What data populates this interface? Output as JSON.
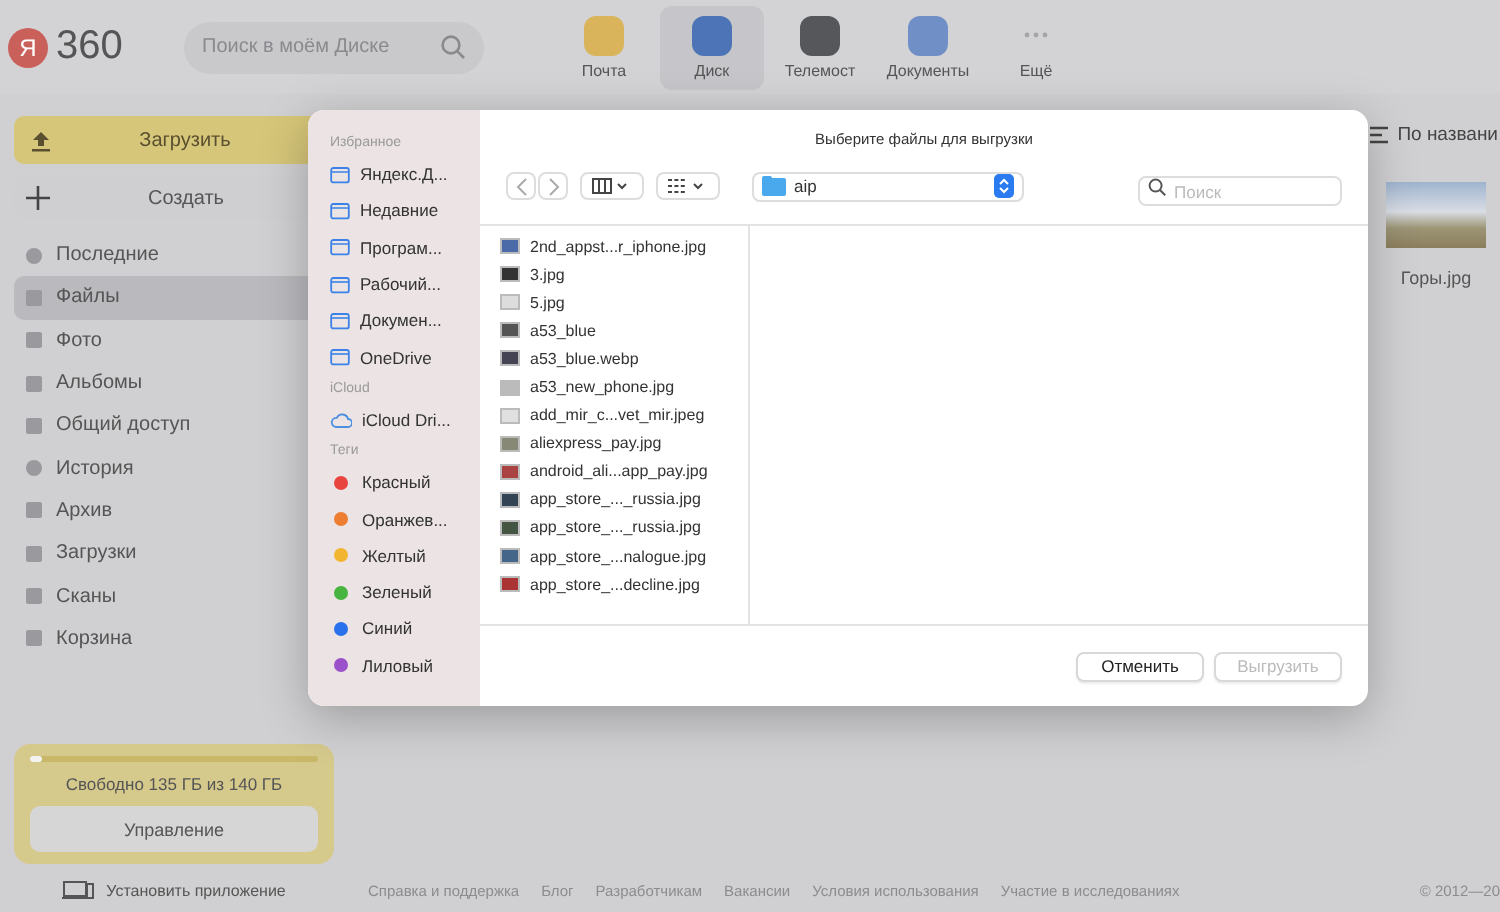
{
  "header": {
    "logo_mark": "Я",
    "logo_text": "360",
    "search": {
      "placeholder": "Поиск в моём Диске"
    },
    "apps": [
      {
        "label": "Почта",
        "selected": false
      },
      {
        "label": "Диск",
        "selected": true
      },
      {
        "label": "Телемост",
        "selected": false
      },
      {
        "label": "Документы",
        "selected": false
      },
      {
        "label": "Ещё",
        "selected": false
      }
    ]
  },
  "sidebar": {
    "upload_button": "Загрузить",
    "create_button": "Создать",
    "items": [
      {
        "label": "Последние",
        "selected": false
      },
      {
        "label": "Файлы",
        "selected": true
      },
      {
        "label": "Фото",
        "selected": false
      },
      {
        "label": "Альбомы",
        "selected": false
      },
      {
        "label": "Общий доступ",
        "selected": false
      },
      {
        "label": "История",
        "selected": false
      },
      {
        "label": "Архив",
        "selected": false
      },
      {
        "label": "Загрузки",
        "selected": false
      },
      {
        "label": "Сканы",
        "selected": false
      },
      {
        "label": "Корзина",
        "selected": false
      }
    ],
    "storage": {
      "text": "Свободно 135 ГБ из 140 ГБ",
      "level": 0.04,
      "button": "Управление"
    },
    "install_app": "Установить приложение"
  },
  "main": {
    "sort": "По названи",
    "files": [
      {
        "name": "Горы.jpg"
      }
    ],
    "footer_links": [
      "Справка и поддержка",
      "Блог",
      "Разработчикам",
      "Вакансии",
      "Условия использования",
      "Участие в исследованиях"
    ],
    "copyright": "© 2012—20"
  },
  "dialog": {
    "title": "Выберите файлы для выгрузки",
    "location": "aip",
    "search": {
      "placeholder": "Поиск"
    },
    "sections": [
      {
        "heading": "Избранное",
        "items": [
          {
            "label": "Яндекс.Д..."
          },
          {
            "label": "Недавние"
          },
          {
            "label": "Програм..."
          },
          {
            "label": "Рабочий..."
          },
          {
            "label": "Докумен..."
          },
          {
            "label": "OneDrive"
          }
        ]
      },
      {
        "heading": "iCloud",
        "items": [
          {
            "label": "iCloud Dri..."
          }
        ]
      },
      {
        "heading": "Теги",
        "items": [
          {
            "label": "Красный",
            "color": "#e9453f"
          },
          {
            "label": "Оранжев...",
            "color": "#ec7d31"
          },
          {
            "label": "Желтый",
            "color": "#f1b532"
          },
          {
            "label": "Зеленый",
            "color": "#47b440"
          },
          {
            "label": "Синий",
            "color": "#2a72ed"
          },
          {
            "label": "Лиловый",
            "color": "#9a51c9"
          }
        ]
      }
    ],
    "files": [
      {
        "name": "2nd_appst...r_iphone.jpg"
      },
      {
        "name": "3.jpg"
      },
      {
        "name": "5.jpg"
      },
      {
        "name": "a53_blue"
      },
      {
        "name": "a53_blue.webp"
      },
      {
        "name": "a53_new_phone.jpg"
      },
      {
        "name": "add_mir_c...vet_mir.jpeg"
      },
      {
        "name": "aliexpress_pay.jpg"
      },
      {
        "name": "android_ali...app_pay.jpg"
      },
      {
        "name": "app_store_..._russia.jpg"
      },
      {
        "name": "app_store_..._russia.jpg"
      },
      {
        "name": "app_store_...nalogue.jpg"
      },
      {
        "name": "app_store_...decline.jpg"
      }
    ],
    "cancel_button": "Отменить",
    "upload_button": {
      "label": "Выгрузить",
      "disabled": true
    }
  }
}
